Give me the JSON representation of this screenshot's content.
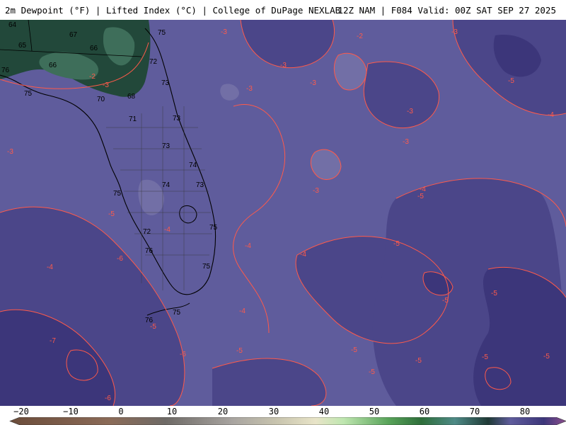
{
  "header": {
    "left_title": "2m Dewpoint (°F) | Lifted Index (°C) | College of DuPage NEXLAB",
    "right_title": "12Z NAM | F084 Valid: 00Z SAT SEP 27 2025"
  },
  "map": {
    "dewpoint_labels": [
      "64",
      "67",
      "65",
      "67",
      "66",
      "75",
      "72",
      "66",
      "68",
      "70",
      "71",
      "73",
      "73",
      "73",
      "74",
      "74",
      "73",
      "75",
      "72",
      "76",
      "75",
      "76",
      "75",
      "75",
      "75",
      "76"
    ],
    "lifted_index_labels": [
      "-3",
      "-3",
      "-2",
      "-3",
      "-3",
      "-3",
      "-3",
      "-3",
      "-2",
      "-5",
      "-4",
      "-3",
      "-3",
      "-3",
      "-4",
      "-5",
      "-5",
      "-5",
      "-4",
      "-5",
      "-4",
      "-4",
      "-4",
      "-5",
      "-5",
      "-5",
      "-5",
      "-6",
      "-7",
      "-6",
      "-5",
      "-5",
      "-5",
      "-5",
      "-6",
      "-4"
    ],
    "colors": {
      "background": "#5f5c9c",
      "dark_shade": "#4b4689",
      "darker_shade": "#3c367a",
      "light_shade": "#726fa6",
      "land_green": "#22483a",
      "land_green_light": "#3e6e5a",
      "contour": "#ff5a4a",
      "coast": "#000000"
    }
  },
  "colorbar": {
    "ticks": [
      "−20",
      "−10",
      "0",
      "10",
      "20",
      "30",
      "40",
      "50",
      "60",
      "70",
      "80"
    ],
    "unit": "°F"
  }
}
